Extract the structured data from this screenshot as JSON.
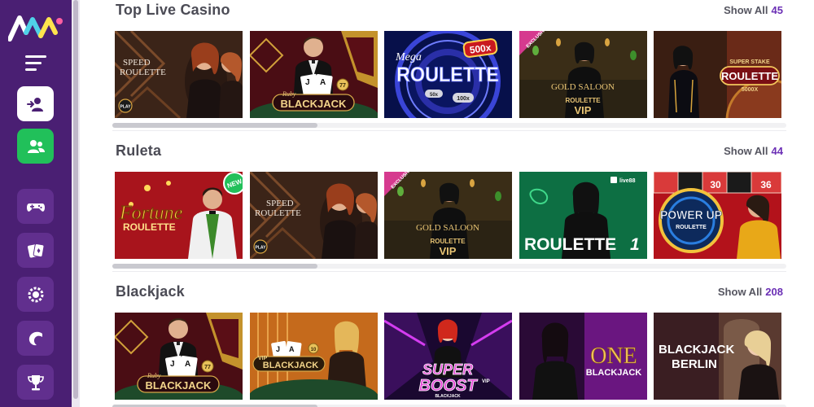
{
  "sidebar": {
    "buttons": [
      {
        "name": "login-icon"
      },
      {
        "name": "register-users-icon"
      },
      {
        "name": "gamepad-icon"
      },
      {
        "name": "cards-icon"
      },
      {
        "name": "roulette-chip-icon"
      },
      {
        "name": "live-casino-icon"
      },
      {
        "name": "trophy-icon"
      }
    ]
  },
  "sections": [
    {
      "title": "Top Live Casino",
      "show_all_label": "Show All",
      "show_all_count": "45",
      "tiles": [
        {
          "l1": "SPEED",
          "l2": "ROULETTE",
          "badge": "PLAY"
        },
        {
          "l1": "Ruby",
          "l2": "BLACKJACK",
          "badge": "77"
        },
        {
          "l1": "Mega",
          "l2": "ROULETTE",
          "badge": "500x",
          "m1": "50x",
          "m2": "100x"
        },
        {
          "l1": "GOLD SALOON",
          "l2": "ROULETTE",
          "l3": "VIP",
          "ribbon": "EXCLUSIVE"
        },
        {
          "l1": "SUPER STAKE",
          "l2": "ROULETTE",
          "l3": "5000X"
        }
      ]
    },
    {
      "title": "Ruleta",
      "show_all_label": "Show All",
      "show_all_count": "44",
      "tiles": [
        {
          "l1": "Fortune",
          "l2": "ROULETTE",
          "badge": "NEW"
        },
        {
          "l1": "SPEED",
          "l2": "ROULETTE",
          "badge": "PLAY"
        },
        {
          "l1": "GOLD SALOON",
          "l2": "ROULETTE",
          "l3": "VIP",
          "ribbon": "EXCLUSIVE"
        },
        {
          "l1": "ROULETTE",
          "l2": "1",
          "badge": "live88"
        },
        {
          "l1": "POWER UP",
          "l2": "ROULETTE"
        }
      ]
    },
    {
      "title": "Blackjack",
      "show_all_label": "Show All",
      "show_all_count": "208",
      "tiles": [
        {
          "l1": "Ruby",
          "l2": "BLACKJACK",
          "badge": "77"
        },
        {
          "l1": "VIP",
          "l2": "BLACKJACK",
          "badge": "10"
        },
        {
          "l1": "SUPER",
          "l2": "BOOST",
          "l3": "BLACKJACK",
          "badge": "VIP"
        },
        {
          "l1": "ONE",
          "l2": "BLACKJACK"
        },
        {
          "l1": "BLACKJACK",
          "l2": "BERLIN"
        }
      ]
    }
  ]
}
